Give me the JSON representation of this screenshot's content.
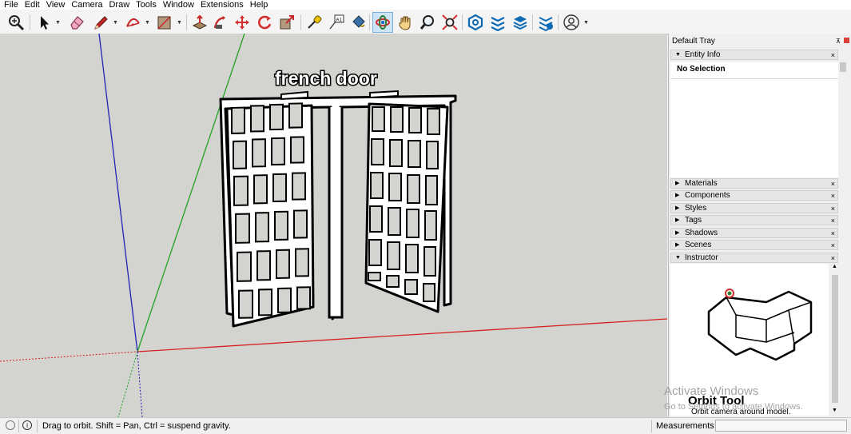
{
  "menu": [
    "File",
    "Edit",
    "View",
    "Camera",
    "Draw",
    "Tools",
    "Window",
    "Extensions",
    "Help"
  ],
  "model_label": "french door",
  "tray": {
    "title": "Default Tray",
    "entity_info": "Entity Info",
    "no_selection": "No Selection",
    "panels": [
      "Materials",
      "Components",
      "Styles",
      "Tags",
      "Shadows",
      "Scenes"
    ],
    "instructor": "Instructor",
    "close_mark": "×",
    "pin_mark": "⊼",
    "expanded_mark": "▼",
    "collapsed_mark": "▶"
  },
  "instructor": {
    "tool_title": "Orbit Tool",
    "tool_desc": "Orbit camera around model."
  },
  "watermark": {
    "line1": "Activate Windows",
    "line2": "Go to Settings to activate Windows."
  },
  "status": {
    "text": "Drag to orbit. Shift = Pan, Ctrl = suspend gravity.",
    "measurements_label": "Measurements",
    "measurements_value": "",
    "info_icon": "i"
  },
  "toolbar": {
    "active_tool": "orbit-icon",
    "tools": [
      "zoom-extents-icon",
      "select-icon",
      "eraser-icon",
      "line-icon",
      "arc-icon",
      "shape-icon",
      "push-pull-icon",
      "follow-me-icon",
      "move-icon",
      "rotate-icon",
      "scale-icon",
      "tape-measure-icon",
      "text-icon",
      "paint-bucket-icon",
      "orbit-icon",
      "pan-icon",
      "zoom-icon",
      "zoom-window-icon",
      "warehouse-icon",
      "extension-icon",
      "layout-icon",
      "sandbox-icon",
      "account-icon"
    ]
  },
  "colors": {
    "axis_red": "#d62020",
    "axis_green": "#1fa31f",
    "axis_blue": "#2323b8",
    "viewport_bg": "#d3d3cf",
    "active_tool_bg": "#cde4f7"
  }
}
